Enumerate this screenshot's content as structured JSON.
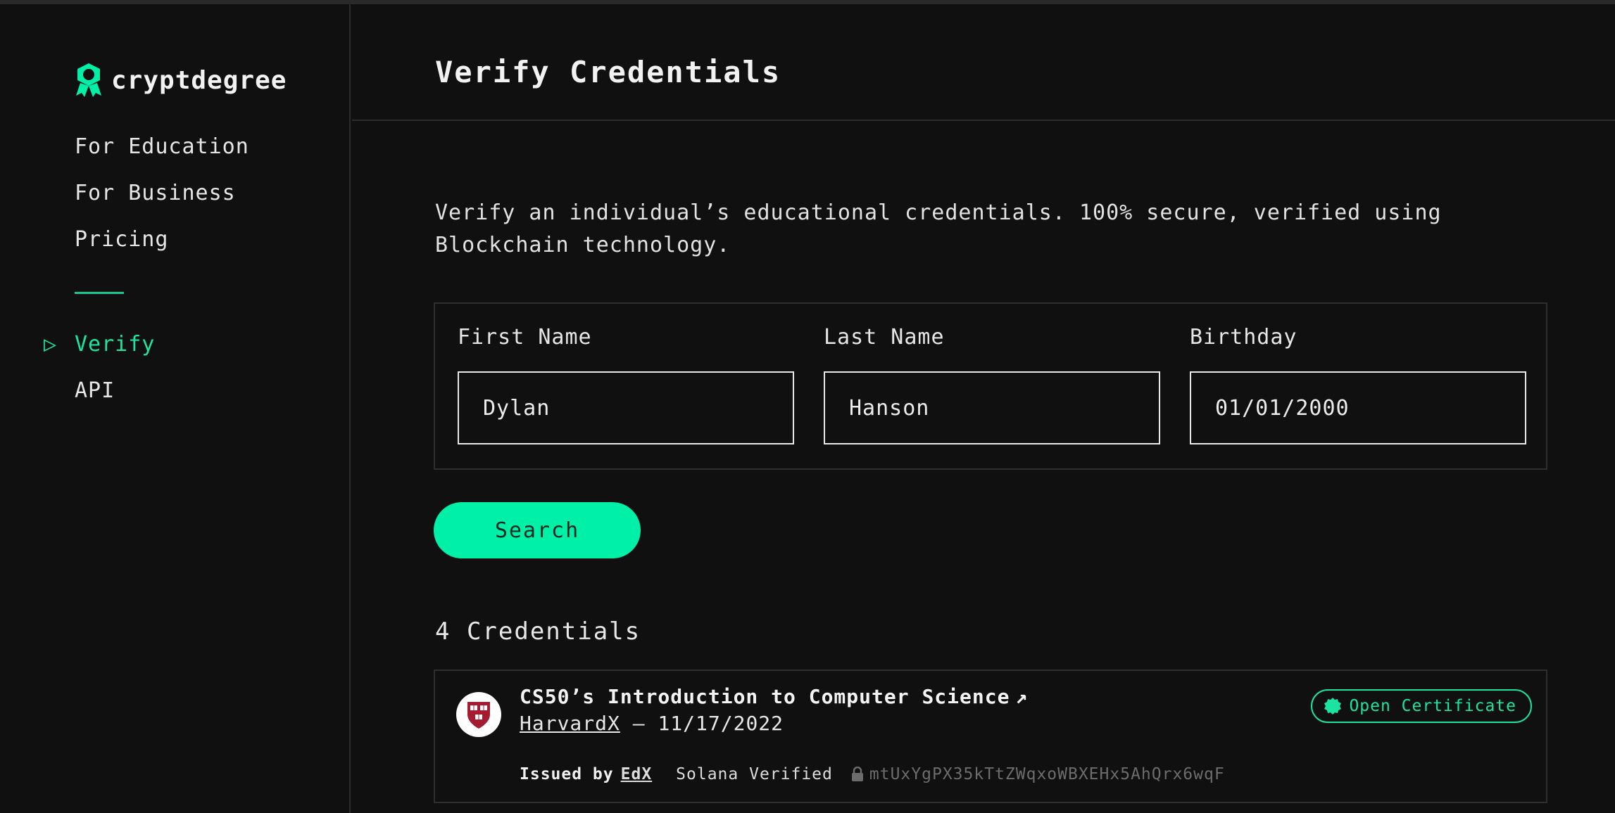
{
  "brand": {
    "name": "cryptdegree",
    "accent_color": "#00f0a8",
    "logo_icon": "award-ribbon-icon"
  },
  "sidebar": {
    "items": [
      {
        "label": "For Education"
      },
      {
        "label": "For Business"
      },
      {
        "label": "Pricing"
      },
      {
        "label": "Verify",
        "active": true
      },
      {
        "label": "API"
      }
    ],
    "active_marker": "▷"
  },
  "header": {
    "title": "Verify Credentials"
  },
  "main": {
    "description": "Verify an individual’s educational credentials. 100% secure, verified using Blockchain technology.",
    "form": {
      "first_name": {
        "label": "First Name",
        "value": "Dylan"
      },
      "last_name": {
        "label": "Last Name",
        "value": "Hanson"
      },
      "birthday": {
        "label": "Birthday",
        "value": "01/01/2000"
      }
    },
    "search_label": "Search",
    "count_label": "4 Credentials",
    "credential": {
      "title": "CS50’s Introduction to Computer Science",
      "title_arrow": "↗",
      "issuer": "HarvardX",
      "separator": "—",
      "date": "11/17/2022",
      "issued_by_label": "Issued by",
      "issued_by": "EdX",
      "verified_label": "Solana Verified",
      "hash": "mtUxYgPX35kTtZWqxoWBXEHx5AhQrx6wqF",
      "open_label": "Open Certificate",
      "school_logo_icon": "harvard-shield-icon"
    }
  }
}
